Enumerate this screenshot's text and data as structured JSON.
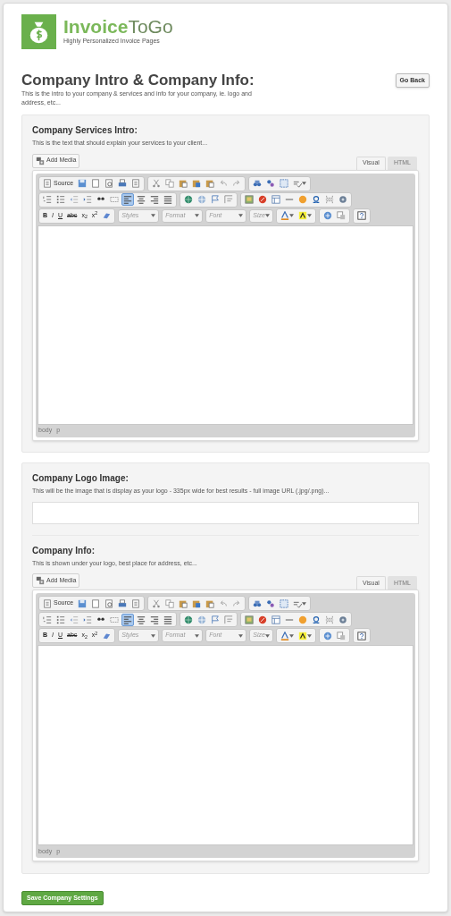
{
  "logo": {
    "name_bold": "Invoice",
    "name_rest": "ToGo",
    "tagline": "Highly Personalized Invoice Pages"
  },
  "header": {
    "title": "Company Intro & Company Info:",
    "description": "This is the intro to your company & services and info for your company, ie. logo and address, etc...",
    "back_button": "Go Back"
  },
  "services": {
    "label": "Company Services Intro:",
    "description": "This is the text that should explain your services to your client...",
    "editor": {
      "add_media": "Add Media",
      "tabs": [
        {
          "label": "Visual",
          "selected": true
        },
        {
          "label": "HTML",
          "selected": false
        }
      ],
      "source_label": "Source",
      "format_buttons": [
        "B",
        "I",
        "U",
        "abc",
        "x$_{2}$",
        "x$^{2}$"
      ],
      "dropdowns": [
        "Styles",
        "Format",
        "Font",
        "Size"
      ],
      "alignment_buttons": [
        {
          "selected": true
        },
        {
          "selected": false
        },
        {
          "selected": false
        },
        {
          "selected": false
        }
      ],
      "path": [
        "body",
        "p"
      ]
    }
  },
  "logo_image": {
    "label": "Company Logo Image:",
    "description": "This will be the image that is display as your logo - 335px wide for best results - full image URL (.jpg/.png)..."
  },
  "company_info": {
    "label": "Company Info:",
    "description": "This is shown under your logo, best place for address, etc...",
    "editor": {
      "add_media": "Add Media",
      "tabs": [
        {
          "label": "Visual",
          "selected": true
        },
        {
          "label": "HTML",
          "selected": false
        }
      ],
      "source_label": "Source",
      "format_buttons": [
        "B",
        "I",
        "U",
        "abc",
        "x$_{2}$",
        "x$^{2}$"
      ],
      "dropdowns": [
        "Styles",
        "Format",
        "Font",
        "Size"
      ],
      "alignment_buttons": [
        {
          "selected": true
        },
        {
          "selected": false
        },
        {
          "selected": false
        },
        {
          "selected": false
        }
      ],
      "path": [
        "body",
        "p"
      ]
    }
  },
  "save_button": "Save Company Settings"
}
